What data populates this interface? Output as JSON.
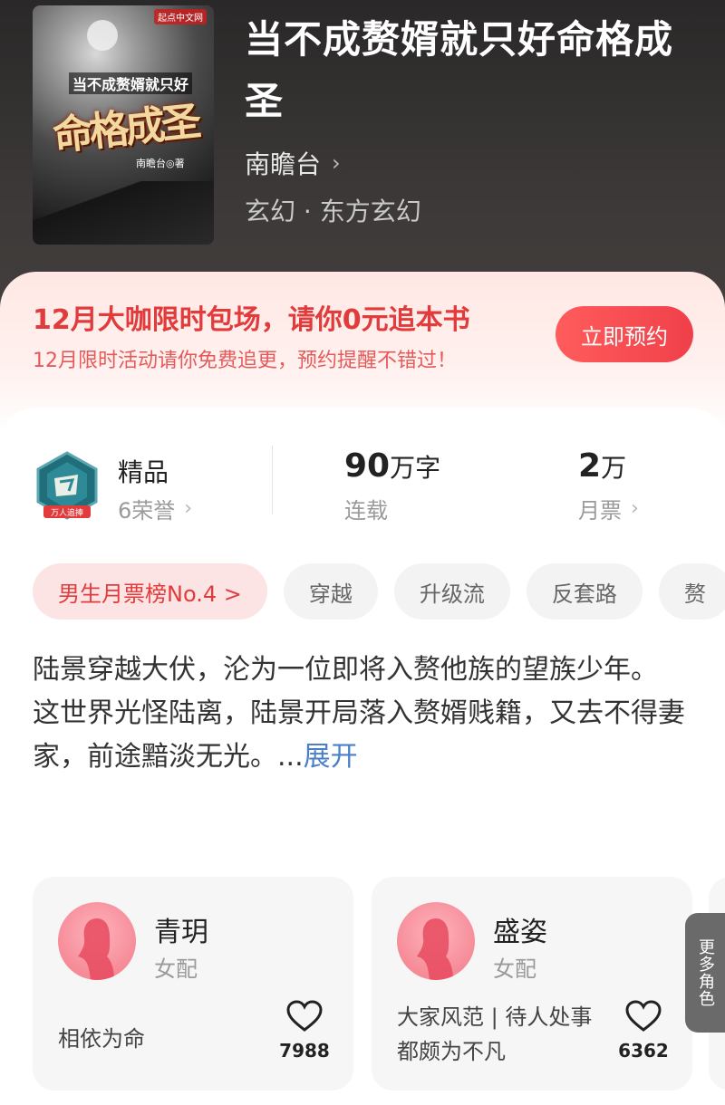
{
  "book": {
    "title": "当不成赘婿就只好命格成圣",
    "author": "南瞻台",
    "genre": "玄幻 · 东方玄幻",
    "cover": {
      "brand": "起点中文网",
      "subtitle": "当不成赘婿就只好",
      "title": "命格成圣",
      "author": "南瞻台◎著"
    }
  },
  "promo": {
    "title": "12月大咖限时包场，请你0元追本书",
    "desc": "12月限时活动请你免费追更，预约提醒不错过！",
    "button": "立即预约"
  },
  "stats": {
    "quality": "精品",
    "honors": "6荣誉",
    "badge_label": "万人追捧",
    "words_value": "90",
    "words_unit": "万字",
    "status": "连载",
    "tickets_value": "2",
    "tickets_unit": "万",
    "tickets_label": "月票"
  },
  "tags": [
    {
      "label": "男生月票榜No.4 >"
    },
    {
      "label": "穿越"
    },
    {
      "label": "升级流"
    },
    {
      "label": "反套路"
    },
    {
      "label": "赘"
    }
  ],
  "intro": {
    "text": "陆景穿越大伏，沦为一位即将入赘他族的望族少年。\n这世界光怪陆离，陆景开局落入赘婿贱籍，又去不得妻家，前途黯淡无光。...",
    "expand": "展开"
  },
  "roles": [
    {
      "name": "青玥",
      "type": "女配",
      "desc": "相依为命",
      "likes": "7988"
    },
    {
      "name": "盛姿",
      "type": "女配",
      "desc": "大家风范 | 待人处事都颇为不凡",
      "likes": "6362"
    }
  ],
  "more_roles": "更多角色",
  "colors": {
    "accent": "#e23b3b",
    "link": "#4b7fc9",
    "button_gradient_start": "#ff5c5c",
    "button_gradient_end": "#f0404a"
  }
}
